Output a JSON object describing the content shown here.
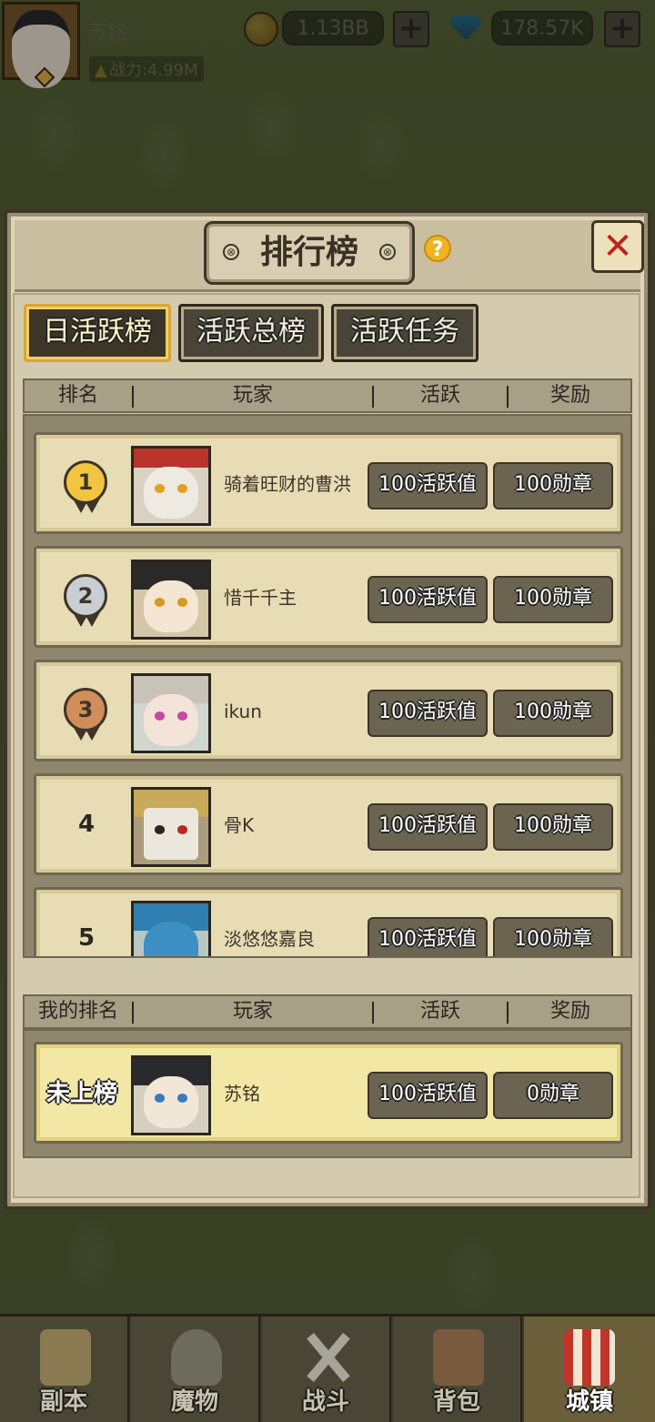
{
  "topbar": {
    "player_name": "苏铭",
    "power_icon": "power-icon",
    "power": "战力:4.99M",
    "gold": "1.13BB",
    "diamonds": "178.57K",
    "plus": "+"
  },
  "panel": {
    "title": "排行榜",
    "help": "?",
    "close": "✕",
    "bolt": "⊗"
  },
  "tabs": [
    {
      "label": "日活跃榜",
      "active": true
    },
    {
      "label": "活跃总榜",
      "active": false
    },
    {
      "label": "活跃任务",
      "active": false
    }
  ],
  "columns": {
    "rank": "排名",
    "player": "玩家",
    "activity": "活跃",
    "reward": "奖励",
    "my_rank": "我的排名"
  },
  "rows": [
    {
      "rank": "1",
      "name": "骑着旺财的曹洪",
      "activity": "100活跃值",
      "reward": "100勋章"
    },
    {
      "rank": "2",
      "name": "惜千千主",
      "activity": "100活跃值",
      "reward": "100勋章"
    },
    {
      "rank": "3",
      "name": "ikun",
      "activity": "100活跃值",
      "reward": "100勋章"
    },
    {
      "rank": "4",
      "name": "骨K",
      "activity": "100活跃值",
      "reward": "100勋章"
    },
    {
      "rank": "5",
      "name": "淡悠悠嘉良",
      "activity": "100活跃值",
      "reward": "100勋章"
    }
  ],
  "my_row": {
    "rank": "未上榜",
    "name": "苏铭",
    "activity": "100活跃值",
    "reward": "0勋章"
  },
  "nav": [
    {
      "label": "副本",
      "icon": "map-icon",
      "active": false
    },
    {
      "label": "魔物",
      "icon": "monster-icon",
      "active": false
    },
    {
      "label": "战斗",
      "icon": "crossed-swords-icon",
      "active": false
    },
    {
      "label": "背包",
      "icon": "backpack-icon",
      "active": false
    },
    {
      "label": "城镇",
      "icon": "town-icon",
      "active": true
    }
  ]
}
